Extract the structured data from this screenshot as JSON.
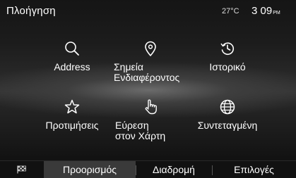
{
  "header": {
    "title": "Πλοήγηση",
    "temperature": "27°C",
    "time": "3 09",
    "ampm": "PM"
  },
  "menu": [
    {
      "label": "Address",
      "icon": "search-icon"
    },
    {
      "label": "Σημεία\nΕνδιαφέροντος",
      "icon": "map-pin-icon"
    },
    {
      "label": "Ιστορικό",
      "icon": "history-icon"
    },
    {
      "label": "Προτιμήσεις",
      "icon": "star-icon"
    },
    {
      "label": "Εύρεση\nστον Χάρτη",
      "icon": "hand-pointer-icon"
    },
    {
      "label": "Συντεταγμένη",
      "icon": "globe-icon"
    }
  ],
  "tabs": {
    "flag_icon": "checkered-flag-icon",
    "destination": "Προορισμός",
    "route": "Διαδρομή",
    "options": "Επιλογές"
  }
}
